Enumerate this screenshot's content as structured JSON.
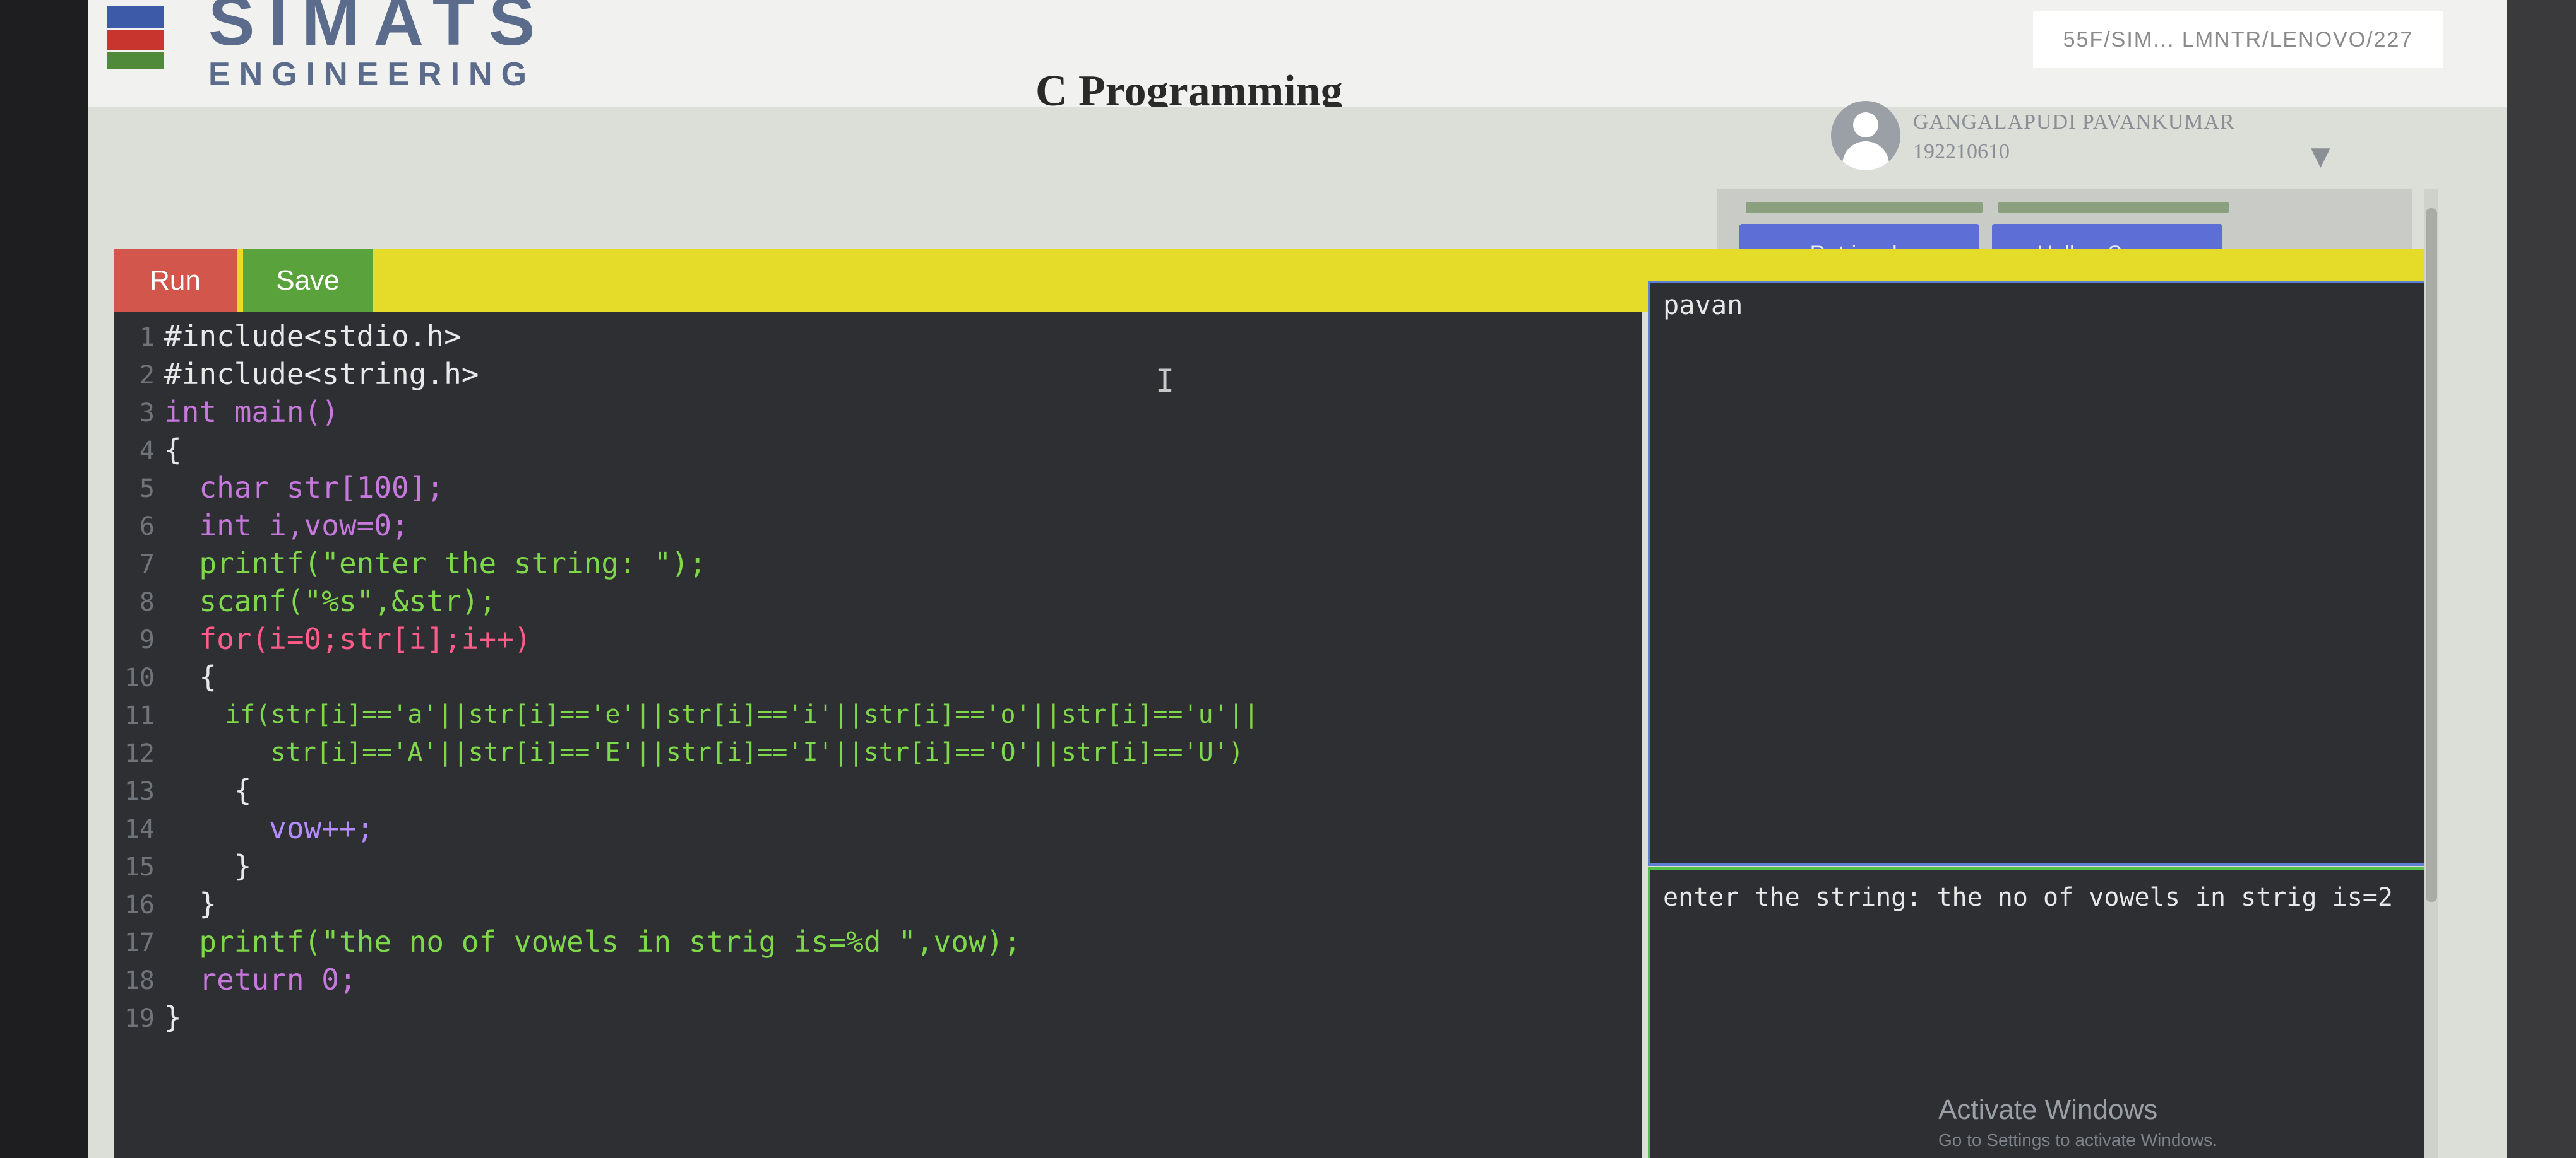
{
  "header": {
    "brand_name": "SIMATS",
    "brand_sub": "ENGINEERING",
    "page_title": "C Programming",
    "top_badge": "55F/SIM...   LMNTR/LENOVO/227",
    "user_name": "GANGALAPUDI PAVANKUMAR",
    "user_id": "192210610",
    "user_caret": "▼"
  },
  "toolbar": {
    "run_label": "Run",
    "save_label": "Save"
  },
  "snippets": {
    "buttons": [
      "R- triangle",
      "Hollow Square"
    ]
  },
  "editor": {
    "line_numbers": [
      "1",
      "2",
      "3",
      "4",
      "5",
      "6",
      "7",
      "8",
      "9",
      "10",
      "11",
      "12",
      "13",
      "14",
      "15",
      "16",
      "17",
      "18",
      "19"
    ],
    "lines": [
      "#include<stdio.h>",
      "#include<string.h>",
      "int main()",
      "{",
      "  char str[100];",
      "  int i,vow=0;",
      "  printf(\"enter the string: \");",
      "  scanf(\"%s\",&str);",
      "  for(i=0;str[i];i++)",
      "  {",
      "    if(str[i]=='a'||str[i]=='e'||str[i]=='i'||str[i]=='o'||str[i]=='u'||",
      "       str[i]=='A'||str[i]=='E'||str[i]=='I'||str[i]=='O'||str[i]=='U')",
      "    {",
      "      vow++;",
      "    }",
      "  }",
      "  printf(\"the no of vowels in strig is=%d \",vow);",
      "  return 0;",
      "}"
    ],
    "cursor_glyph": "I"
  },
  "io": {
    "input_text": "pavan",
    "output_text": "enter the string: the no of vowels in strig is=2"
  },
  "watermark": {
    "title": "Activate Windows",
    "subtitle": "Go to Settings to activate Windows."
  },
  "colors": {
    "run": "#d2564c",
    "save": "#5aa33c",
    "toolbar": "#e5dc2a",
    "snippet": "#5d6fd6",
    "editor_bg": "#2d2f33",
    "input_border": "#5d7fd6",
    "output_border": "#52c04a"
  }
}
